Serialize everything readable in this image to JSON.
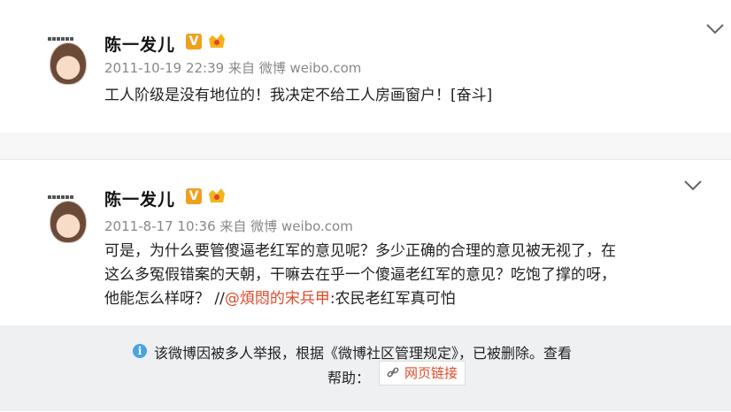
{
  "posts": [
    {
      "author": "陈一发儿",
      "verified_badge": "V",
      "timestamp": "2011-10-19 22:39",
      "source": "来自 微博 weibo.com",
      "content": "工人阶级是没有地位的！我决定不给工人房画窗户！[奋斗]"
    },
    {
      "author": "陈一发儿",
      "verified_badge": "V",
      "timestamp": "2011-8-17 10:36",
      "source": "来自 微博 weibo.com",
      "content_line1": "可是，为什么要管傻逼老红军的意见呢？多少正确的合理的意见被无视了，在",
      "content_line2": "这么多冤假错案的天朝，干嘛去在乎一个傻逼老红军的意见？吃饱了撑的呀，",
      "content_line3_prefix": "他能怎么样呀？ //",
      "mention": "@煩悶的宋兵甲",
      "content_line3_suffix": ":农民老红军真可怕"
    }
  ],
  "notice": {
    "line1": "该微博因被多人举报，根据《微博社区管理规定》，已被删除。查看",
    "line2_label": "帮助：",
    "link_label": "网页链接"
  },
  "icons": [
    "avatar",
    "verified-icon",
    "vip-crown-icon",
    "chevron-down-icon",
    "info-icon",
    "link-icon"
  ],
  "colors": {
    "verified": "#f0a020",
    "mention": "#e04a2a",
    "notice_bg": "#eef0f2",
    "info": "#4aa3df"
  }
}
